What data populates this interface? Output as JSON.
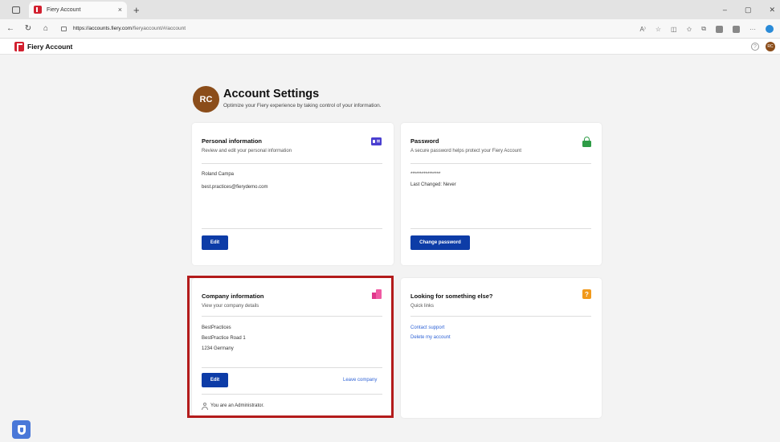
{
  "browser": {
    "tab_title": "Fiery Account",
    "tab_close": "×",
    "new_tab": "+",
    "url_domain": "https://accounts.fiery.com",
    "url_path": "/fieryaccount/#/account",
    "minimize": "–",
    "maximize": "▢",
    "close": "✕",
    "nav": {
      "back": "←",
      "refresh": "↻",
      "home": "⌂"
    },
    "tools": {
      "read_aloud": "A⁾",
      "favorite": "☆",
      "split": "◫",
      "favorites": "✩",
      "collections": "⧉",
      "more": "···"
    }
  },
  "app": {
    "brand": "Fiery Account",
    "help": "?",
    "user_initials": "RC"
  },
  "header": {
    "initials": "RC",
    "title": "Account Settings",
    "subtitle": "Optimize your Fiery experience by taking control of your information."
  },
  "personal": {
    "title": "Personal information",
    "subtitle": "Review and edit your personal information",
    "name": "Roland Campa",
    "email": "best.practices@fierydemo.com",
    "edit_label": "Edit"
  },
  "password": {
    "title": "Password",
    "subtitle": "A secure password helps protect your Fiery Account",
    "masked": "****************",
    "last_changed": "Last Changed: Never",
    "change_label": "Change password"
  },
  "company": {
    "title": "Company information",
    "subtitle": "View your company details",
    "name": "BestPractices",
    "street": "BestPractice Road 1",
    "city": "1234 Germany",
    "edit_label": "Edit",
    "leave_label": "Leave company",
    "role_text": "You are an Administrator."
  },
  "quick": {
    "title": "Looking for something else?",
    "subtitle": "Quick links",
    "help_glyph": "?",
    "links": [
      "Contact support",
      "Delete my account"
    ]
  },
  "colors": {
    "primary_button": "#0d3ca7",
    "brand_red": "#d2202f",
    "highlight": "#b31b1b"
  }
}
